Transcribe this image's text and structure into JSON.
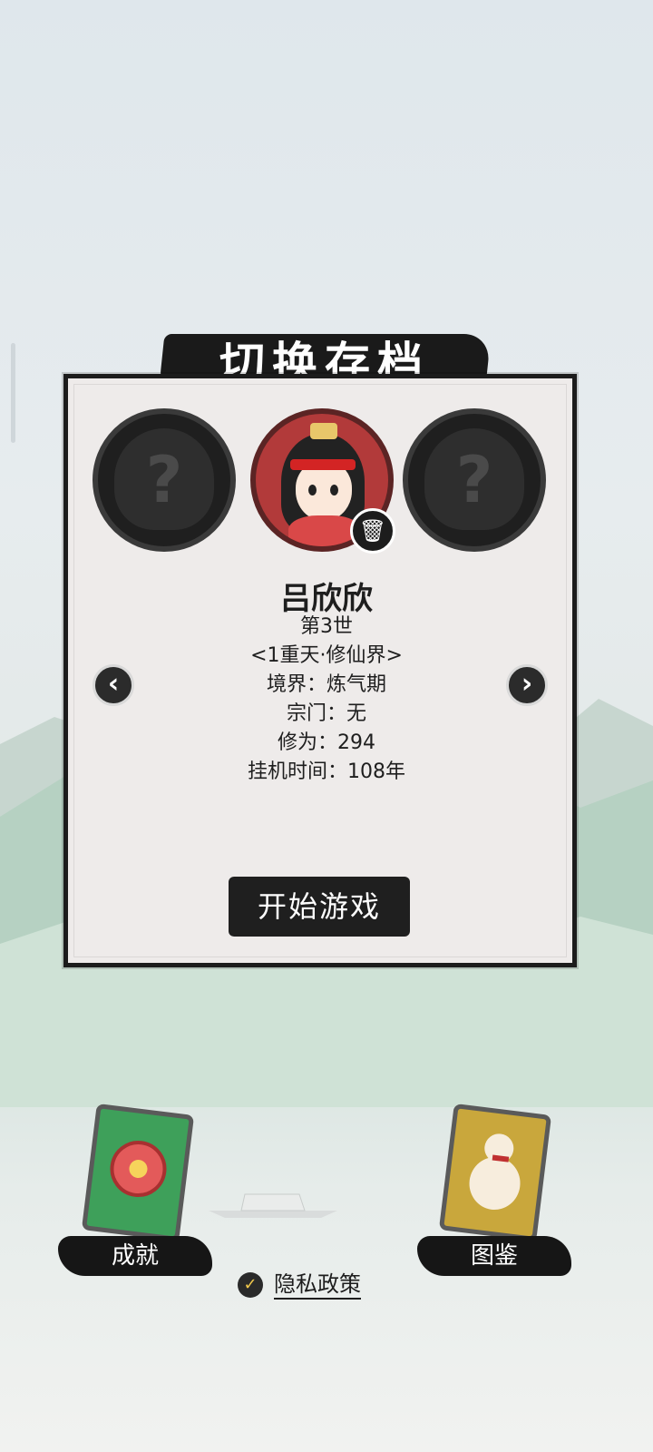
{
  "title": "切换存档",
  "slots": {
    "left_placeholder": "?",
    "right_placeholder": "?"
  },
  "character": {
    "name": "吕欣欣",
    "generation": "第3世",
    "world": "<1重天·修仙界>",
    "realm": "境界：炼气期",
    "sect": "宗门：无",
    "cultivation": "修为：294",
    "idle_time": "挂机时间：108年"
  },
  "icons": {
    "delete": "trash-icon",
    "prev": "chevron-left-icon",
    "next": "chevron-right-icon",
    "check": "check-icon"
  },
  "buttons": {
    "start": "开始游戏",
    "prev": "‹",
    "next": "›",
    "trash": "🗑"
  },
  "bottom": {
    "achievements": "成就",
    "codex": "图鉴",
    "privacy": "隐私政策"
  },
  "colors": {
    "panel": "#eeebea",
    "ink": "#1c1c1c",
    "active_avatar": "#b23a3a",
    "achievement_card": "#3ea05a",
    "codex_card": "#c9a73c"
  }
}
